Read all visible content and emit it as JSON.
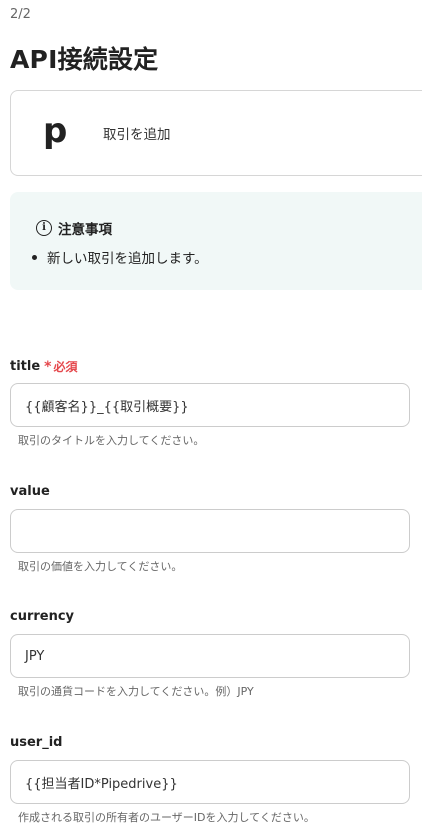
{
  "header": {
    "step": "2/2",
    "title": "API接続設定"
  },
  "app_card": {
    "logo_letter": "p",
    "action_label": "取引を追加"
  },
  "notice": {
    "icon": "info-icon",
    "title": "注意事項",
    "items": [
      "新しい取引を追加します。"
    ]
  },
  "fields": [
    {
      "label": "title",
      "required": true,
      "required_text": "必須",
      "value": "{{顧客名}}_{{取引概要}}",
      "help": "取引のタイトルを入力してください。"
    },
    {
      "label": "value",
      "required": false,
      "value": "",
      "help": "取引の価値を入力してください。"
    },
    {
      "label": "currency",
      "required": false,
      "value": "JPY",
      "help": "取引の通貨コードを入力してください。例）JPY"
    },
    {
      "label": "user_id",
      "required": false,
      "value": "{{担当者ID*Pipedrive}}",
      "help": "作成される取引の所有者のユーザーIDを入力してください。"
    }
  ],
  "colors": {
    "required_accent": "#e5484d",
    "notice_background": "#f1f8f7"
  }
}
